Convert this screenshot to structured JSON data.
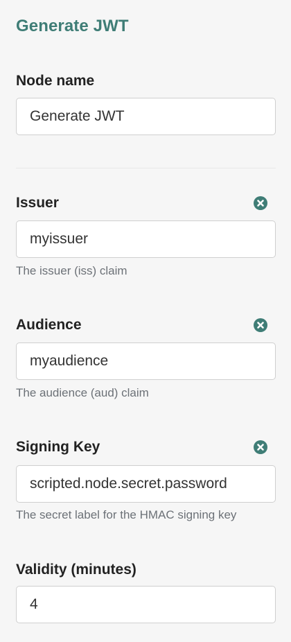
{
  "panel": {
    "title": "Generate JWT"
  },
  "node_name": {
    "label": "Node name",
    "value": "Generate JWT"
  },
  "issuer": {
    "label": "Issuer",
    "value": "myissuer",
    "help": "The issuer (iss) claim",
    "clear_icon": "clear-icon"
  },
  "audience": {
    "label": "Audience",
    "value": "myaudience",
    "help": "The audience (aud) claim",
    "clear_icon": "clear-icon"
  },
  "signing_key": {
    "label": "Signing Key",
    "value": "scripted.node.secret.password",
    "help": "The secret label for the HMAC signing key",
    "clear_icon": "clear-icon"
  },
  "validity": {
    "label": "Validity (minutes)",
    "value": "4"
  },
  "colors": {
    "accent": "#3f7d76",
    "help_text": "#6c7177",
    "background": "#f6f6f6"
  }
}
